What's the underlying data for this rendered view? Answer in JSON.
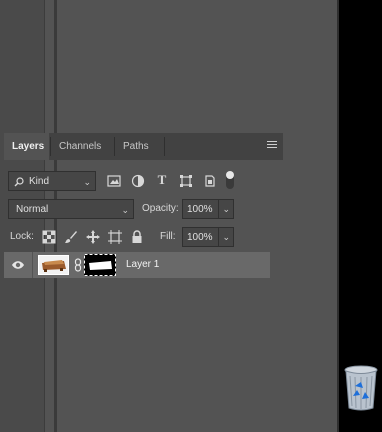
{
  "tabs": [
    {
      "label": "Layers",
      "active": true
    },
    {
      "label": "Channels",
      "active": false
    },
    {
      "label": "Paths",
      "active": false
    }
  ],
  "filter": {
    "kind_label": "Kind"
  },
  "blend": {
    "mode": "Normal",
    "opacity_label": "Opacity:",
    "opacity_value": "100%"
  },
  "lock": {
    "label": "Lock:",
    "fill_label": "Fill:",
    "fill_value": "100%"
  },
  "layers": [
    {
      "name": "Layer 1",
      "visible": true
    }
  ],
  "colors": {
    "panel_bg": "#535353",
    "tabbar_bg": "#424242",
    "selected_layer_bg": "#696969",
    "desktop_bg": "#000000"
  }
}
